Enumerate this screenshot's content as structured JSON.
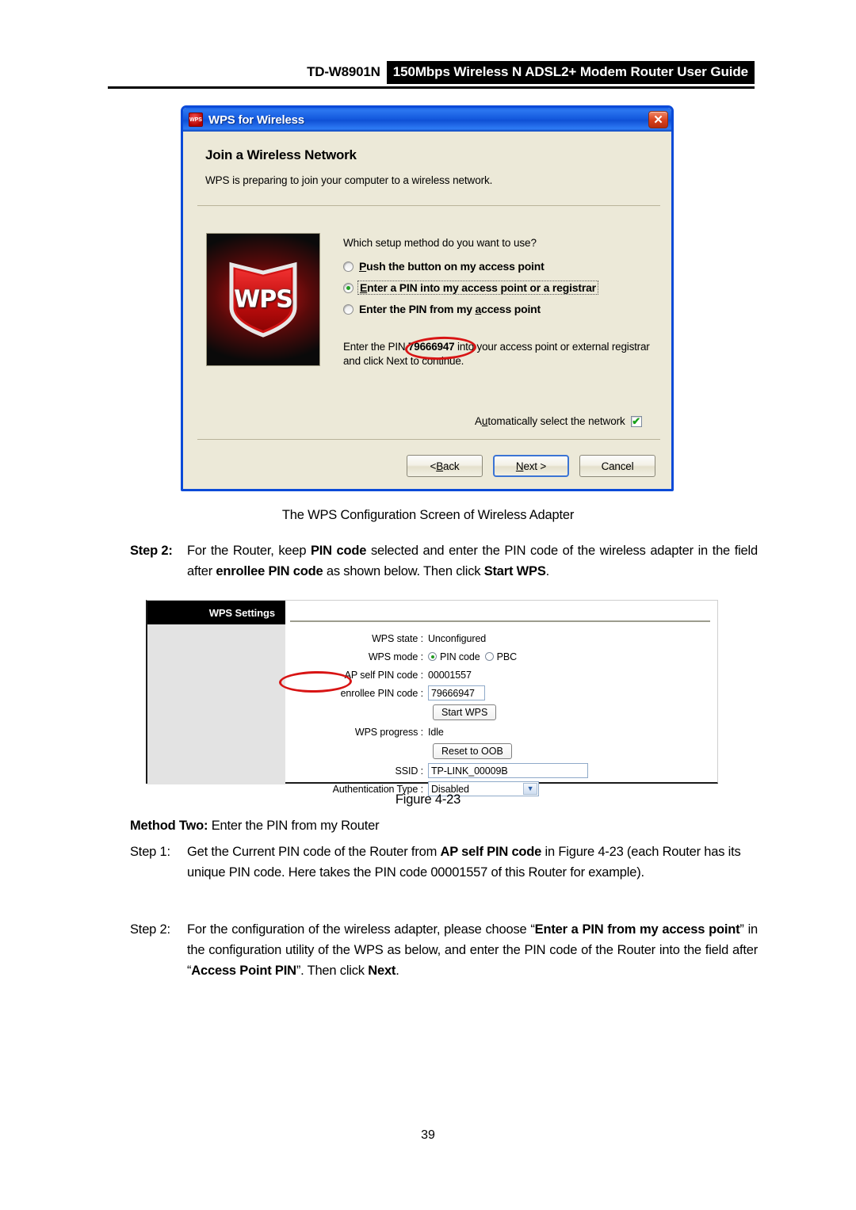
{
  "header": {
    "model": "TD-W8901N",
    "title": "150Mbps Wireless N ADSL2+ Modem Router User Guide"
  },
  "wps_dialog": {
    "titlebar": {
      "icon_label": "WPS",
      "title": "WPS for Wireless",
      "close_label": "✕"
    },
    "heading": "Join a Wireless Network",
    "subtext": "WPS is preparing to join your computer to a wireless network.",
    "logo_text": "WPS",
    "question": "Which setup method do you want to use?",
    "options": [
      {
        "label": "Push the button on my access point",
        "accesskey": "P",
        "selected": false,
        "focused": false
      },
      {
        "label": "Enter a PIN into my access point or a registrar",
        "accesskey": "E",
        "selected": true,
        "focused": true
      },
      {
        "label": "Enter the PIN from my access point",
        "accesskey": "a",
        "selected": false,
        "focused": false
      }
    ],
    "pin_instruction_pre": "Enter the PIN ",
    "pin_value": "79666947",
    "pin_instruction_post": " into your access point or external registrar and click Next to continue.",
    "auto_select_label": "Automatically select the network",
    "auto_select_checked": true,
    "check_glyph": "✔",
    "buttons": {
      "back": "< Back",
      "next": "Next >",
      "cancel": "Cancel"
    }
  },
  "caption_adapter": "The WPS Configuration Screen of Wireless Adapter",
  "step2_top": {
    "label": "Step 2:",
    "text_parts": [
      {
        "t": "For the Router, keep ",
        "b": false
      },
      {
        "t": "PIN code",
        "b": true
      },
      {
        "t": " selected and enter the PIN code of the wireless adapter in the field after ",
        "b": false
      },
      {
        "t": "enrollee PIN code",
        "b": true
      },
      {
        "t": " as shown below. Then click ",
        "b": false
      },
      {
        "t": "Start WPS",
        "b": true
      },
      {
        "t": ".",
        "b": false
      }
    ]
  },
  "router_figure": {
    "panel_title": "WPS Settings",
    "rows": [
      {
        "label": "WPS state :",
        "value": "Unconfigured",
        "type": "text"
      },
      {
        "label": "WPS mode :",
        "type": "radios",
        "options": [
          {
            "label": "PIN code",
            "selected": true
          },
          {
            "label": "PBC",
            "selected": false
          }
        ]
      },
      {
        "label": "AP self PIN code :",
        "value": "00001557",
        "type": "text"
      },
      {
        "label": "enrollee PIN code :",
        "value": "79666947",
        "type": "input-pin"
      },
      {
        "label": "",
        "value": "Start WPS",
        "type": "button"
      },
      {
        "label": "WPS progress :",
        "value": "Idle",
        "type": "text"
      },
      {
        "label": "",
        "value": "Reset to OOB",
        "type": "button"
      },
      {
        "label": "SSID :",
        "value": "TP-LINK_00009B",
        "type": "input-ssid"
      },
      {
        "label": "Authentication Type :",
        "value": "Disabled",
        "type": "select"
      }
    ],
    "select_arrow": "▼"
  },
  "caption_figure": "Figure 4-23",
  "method_two": {
    "label": "Method Two:",
    "text": " Enter the PIN from my Router"
  },
  "step1_bottom": {
    "label": "Step 1:",
    "text_parts": [
      {
        "t": "Get the Current PIN code of the Router from ",
        "b": false
      },
      {
        "t": "AP self PIN code",
        "b": true
      },
      {
        "t": " in Figure 4-23 (each Router has its unique PIN code. Here takes the PIN code 00001557 of this Router for example).",
        "b": false
      }
    ]
  },
  "step2_bottom": {
    "label": "Step 2:",
    "text_parts": [
      {
        "t": "For the configuration of the wireless adapter, please choose “",
        "b": false
      },
      {
        "t": "Enter a PIN from my access point",
        "b": true
      },
      {
        "t": "” in the configuration utility of the WPS as below, and enter the PIN code of the Router into the field after “",
        "b": false
      },
      {
        "t": "Access Point PIN",
        "b": true
      },
      {
        "t": "”. Then click ",
        "b": false
      },
      {
        "t": "Next",
        "b": true
      },
      {
        "t": ".",
        "b": false
      }
    ]
  },
  "page_number": "39"
}
